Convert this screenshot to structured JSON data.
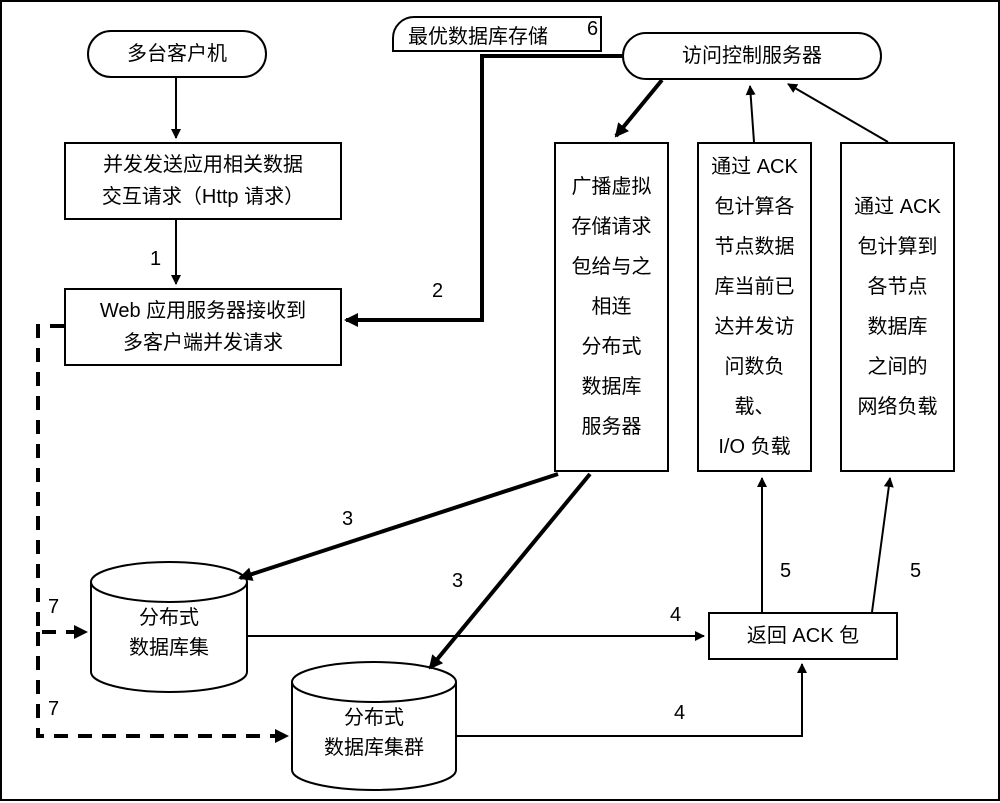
{
  "nodes": {
    "clients": "多台客户机",
    "http_req": "并发发送应用相关数据\n交互请求（Http 请求）",
    "web_server": "Web 应用服务器接收到\n多客户端并发请求",
    "access_ctrl": "访问控制服务器",
    "broadcast": "广播虚拟\n存储请求\n包给与之\n相连\n分布式\n数据库\n服务器",
    "calc_io": "通过 ACK\n包计算各\n节点数据\n库当前已\n达并发访\n问数负载、\nI/O 负载",
    "calc_net": "通过 ACK\n包计算到\n各节点\n数据库\n之间的\n网络负载",
    "ack": "返回 ACK 包",
    "db1": "分布式\n数据库集",
    "db2": "分布式\n数据库集群",
    "tab": "最优数据库存储"
  },
  "nums": {
    "n1": "1",
    "n2": "2",
    "n3a": "3",
    "n3b": "3",
    "n4a": "4",
    "n4b": "4",
    "n5a": "5",
    "n5b": "5",
    "n6": "6",
    "n7a": "7",
    "n7b": "7"
  }
}
